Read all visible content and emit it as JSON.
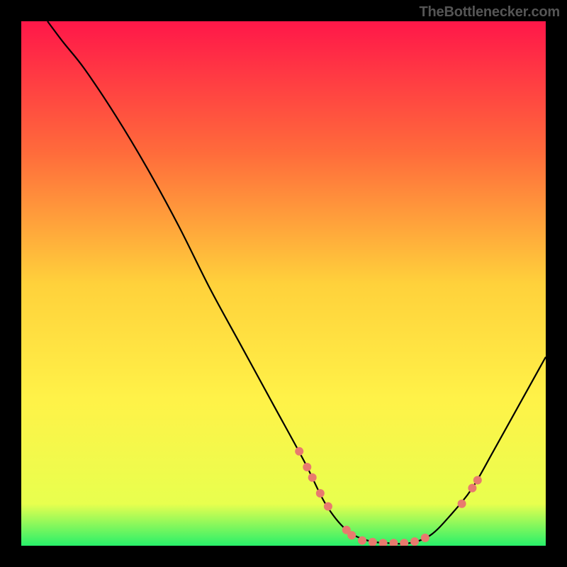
{
  "attribution": "TheBottlenecker.com",
  "chart_data": {
    "type": "line",
    "title": "",
    "xlabel": "",
    "ylabel": "",
    "xlim": [
      0,
      100
    ],
    "ylim": [
      0,
      100
    ],
    "background_gradient_stops": [
      {
        "offset": 0,
        "color": "#ff1749"
      },
      {
        "offset": 25,
        "color": "#ff6b3b"
      },
      {
        "offset": 50,
        "color": "#ffd13b"
      },
      {
        "offset": 72,
        "color": "#fff248"
      },
      {
        "offset": 92,
        "color": "#e8ff4e"
      },
      {
        "offset": 100,
        "color": "#28f06a"
      }
    ],
    "series": [
      {
        "name": "bottleneck-curve",
        "color": "#000000",
        "points": [
          {
            "x": 5.0,
            "y": 100.0
          },
          {
            "x": 8.0,
            "y": 96.0
          },
          {
            "x": 12.0,
            "y": 91.0
          },
          {
            "x": 18.0,
            "y": 82.0
          },
          {
            "x": 24.0,
            "y": 72.0
          },
          {
            "x": 30.0,
            "y": 61.0
          },
          {
            "x": 36.0,
            "y": 49.0
          },
          {
            "x": 42.0,
            "y": 38.0
          },
          {
            "x": 48.0,
            "y": 27.0
          },
          {
            "x": 54.0,
            "y": 16.0
          },
          {
            "x": 58.0,
            "y": 8.0
          },
          {
            "x": 62.0,
            "y": 3.0
          },
          {
            "x": 66.0,
            "y": 1.0
          },
          {
            "x": 70.0,
            "y": 0.5
          },
          {
            "x": 74.0,
            "y": 0.5
          },
          {
            "x": 78.0,
            "y": 2.0
          },
          {
            "x": 82.0,
            "y": 6.0
          },
          {
            "x": 86.0,
            "y": 11.0
          },
          {
            "x": 90.0,
            "y": 18.0
          },
          {
            "x": 95.0,
            "y": 27.0
          },
          {
            "x": 100.0,
            "y": 36.0
          }
        ]
      }
    ],
    "markers": {
      "name": "highlighted-points",
      "color": "#e87a6e",
      "radius": 6,
      "points": [
        {
          "x": 53.0,
          "y": 18.0
        },
        {
          "x": 54.5,
          "y": 15.0
        },
        {
          "x": 55.5,
          "y": 13.0
        },
        {
          "x": 57.0,
          "y": 10.0
        },
        {
          "x": 58.5,
          "y": 7.5
        },
        {
          "x": 62.0,
          "y": 3.0
        },
        {
          "x": 63.0,
          "y": 2.0
        },
        {
          "x": 65.0,
          "y": 1.0
        },
        {
          "x": 67.0,
          "y": 0.7
        },
        {
          "x": 69.0,
          "y": 0.5
        },
        {
          "x": 71.0,
          "y": 0.5
        },
        {
          "x": 73.0,
          "y": 0.5
        },
        {
          "x": 75.0,
          "y": 0.8
        },
        {
          "x": 77.0,
          "y": 1.5
        },
        {
          "x": 84.0,
          "y": 8.0
        },
        {
          "x": 86.0,
          "y": 11.0
        },
        {
          "x": 87.0,
          "y": 12.5
        }
      ]
    }
  }
}
